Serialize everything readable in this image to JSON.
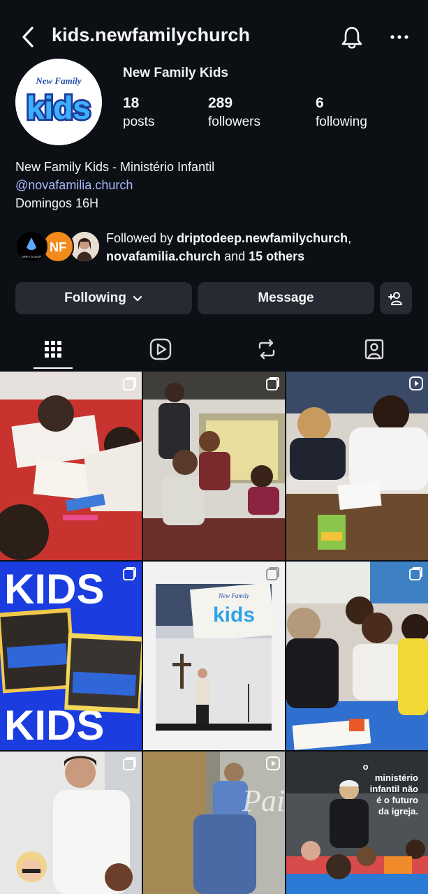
{
  "header": {
    "username": "kids.newfamilychurch",
    "back_icon": "chevron-left-icon",
    "bell_icon": "bell-icon",
    "more_icon": "more-horizontal-icon"
  },
  "profile": {
    "avatar_brand_top": "New Family",
    "avatar_brand_main": "kids",
    "display_name": "New Family Kids",
    "stats": [
      {
        "count": "18",
        "label": "posts"
      },
      {
        "count": "289",
        "label": "followers"
      },
      {
        "count": "6",
        "label": "following"
      }
    ],
    "bio": {
      "line1": "New Family Kids - Ministério Infantil",
      "link": "@novafamilia.church",
      "line3": "Domingos 16H"
    }
  },
  "followed_by": {
    "prefix": "Followed by ",
    "name1": "driptodeep.newfamilychurch",
    "sep": ",",
    "name2": "novafamilia.church",
    "and": " and ",
    "others": "15 others",
    "avatar1_text": "DRIP TO DEEP",
    "avatar2_text": "NF"
  },
  "actions": {
    "following_label": "Following",
    "message_label": "Message",
    "add_user_icon": "add-person-icon"
  },
  "tabs": [
    {
      "name": "grid",
      "icon": "grid-icon",
      "active": true
    },
    {
      "name": "reels",
      "icon": "reels-icon"
    },
    {
      "name": "reposts",
      "icon": "repost-icon"
    },
    {
      "name": "tagged",
      "icon": "tagged-icon"
    }
  ],
  "posts": [
    {
      "kind": "multi",
      "desc": "children coloring at table"
    },
    {
      "kind": "multi",
      "desc": "teacher with kids in classroom"
    },
    {
      "kind": "reel",
      "desc": "kids drawing at desks"
    },
    {
      "kind": "multi",
      "text_top": "KIDS",
      "text_bottom": "KIDS"
    },
    {
      "kind": "multi",
      "desc": "speaker on stage",
      "stage_top": "New Family",
      "stage_main": "kids"
    },
    {
      "kind": "multi",
      "desc": "teacher with girls crafting"
    },
    {
      "kind": "multi",
      "desc": "man with child"
    },
    {
      "kind": "reel",
      "overlay": "Pais"
    },
    {
      "kind": "none",
      "caption_lines": [
        "o",
        "ministério",
        "infantil não",
        "é o futuro",
        "da igreja."
      ]
    }
  ]
}
